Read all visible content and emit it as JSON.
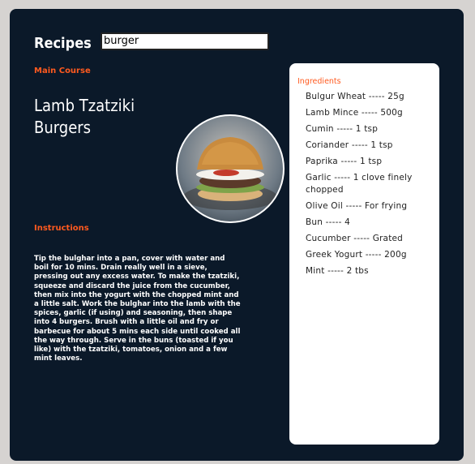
{
  "header": {
    "title": "Recipes"
  },
  "search": {
    "value": "burger"
  },
  "recipe": {
    "category": "Main Course",
    "title": "Lamb Tzatziki Burgers",
    "instructions_label": "Instructions",
    "instructions": "Tip the bulghar into a pan, cover with water and boil for 10 mins. Drain really well in a sieve, pressing out any excess water. To make the tzatziki, squeeze and discard the juice from the cucumber, then mix into the yogurt with the chopped mint and a little salt. Work the bulghar into the lamb with the spices, garlic (if using) and seasoning, then shape into 4 burgers. Brush with a little oil and fry or barbecue for about 5 mins each side until cooked all the way through. Serve in the buns (toasted if you like) with the tzatziki, tomatoes, onion and a few mint leaves."
  },
  "ingredients": {
    "label": "Ingredients",
    "items": [
      "Bulgur Wheat ----- 25g",
      "Lamb Mince ----- 500g",
      "Cumin ----- 1 tsp",
      "Coriander ----- 1 tsp",
      "Paprika ----- 1 tsp",
      "Garlic ----- 1 clove finely chopped",
      "Olive Oil ----- For frying",
      "Bun ----- 4",
      "Cucumber ----- Grated",
      "Greek Yogurt ----- 200g",
      "Mint ----- 2 tbs"
    ]
  },
  "colors": {
    "background": "#0b1929",
    "accent": "#ff5a1f",
    "page": "#d6d3d1"
  }
}
